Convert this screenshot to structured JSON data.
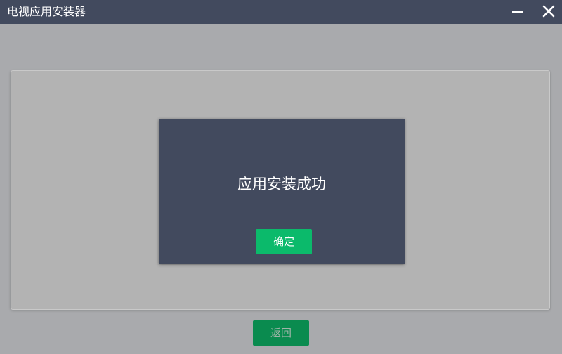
{
  "window": {
    "title": "电视应用安装器",
    "controls": {
      "minimize_icon": "minimize-icon",
      "close_icon": "close-icon"
    }
  },
  "dialog": {
    "message": "应用安装成功",
    "confirm_label": "确定"
  },
  "footer": {
    "back_label": "返回"
  },
  "colors": {
    "titlebar": "#424a5e",
    "background": "#a9aaad",
    "panel": "#b3b3b3",
    "dialog": "#424a5e",
    "confirm_button": "#0bba6b",
    "back_button": "#0a8b4f"
  }
}
